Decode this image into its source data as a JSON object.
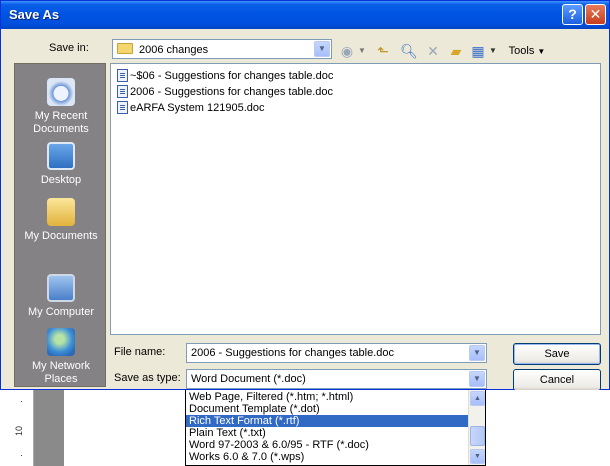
{
  "window": {
    "title": "Save As",
    "help": "?",
    "close": "✕"
  },
  "save_in": {
    "label": "Save in:",
    "value": "2006 changes",
    "icon": "folder-icon"
  },
  "toolbar": {
    "back_icon": "back-icon",
    "up_icon": "up-folder-icon",
    "search_icon": "search-web-icon",
    "delete_icon": "delete-icon",
    "newfolder_icon": "new-folder-icon",
    "views_icon": "views-icon",
    "tools_label": "Tools"
  },
  "places": [
    {
      "label": "My Recent Documents",
      "icon": "recent-documents-icon"
    },
    {
      "label": "Desktop",
      "icon": "desktop-icon"
    },
    {
      "label": "My Documents",
      "icon": "my-documents-icon"
    },
    {
      "label": "My Computer",
      "icon": "my-computer-icon"
    },
    {
      "label": "My Network Places",
      "icon": "network-places-icon"
    }
  ],
  "files": [
    "~$06 - Suggestions for changes table.doc",
    "2006 - Suggestions for changes table.doc",
    "eARFA System 121905.doc"
  ],
  "filename": {
    "label": "File name:",
    "value": "2006 - Suggestions for changes table.doc"
  },
  "savetype": {
    "label": "Save as type:",
    "value": "Word Document (*.doc)",
    "options": [
      "Web Page, Filtered (*.htm; *.html)",
      "Document Template (*.dot)",
      "Rich Text Format (*.rtf)",
      "Plain Text (*.txt)",
      "Word 97-2003 & 6.0/95 - RTF (*.doc)",
      "Works 6.0 & 7.0 (*.wps)"
    ],
    "selected": "Rich Text Format (*.rtf)"
  },
  "buttons": {
    "save": "Save",
    "cancel": "Cancel"
  },
  "ruler": {
    "mark": "10"
  },
  "colors": {
    "titlebar": "#0054e3",
    "selection": "#316ac5",
    "places_bg": "#848284",
    "dialog_bg": "#ece9d8"
  }
}
